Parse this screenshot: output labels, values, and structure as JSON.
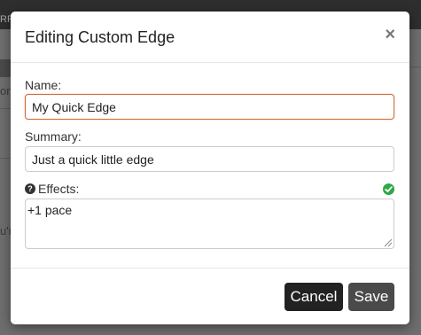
{
  "background": {
    "topbar_text": "RPO",
    "snippet_left_1": "onc",
    "snippet_left_2": "u'r"
  },
  "modal": {
    "title": "Editing Custom Edge",
    "close_symbol": "×",
    "name_label": "Name:",
    "name_value": "My Quick Edge",
    "summary_label": "Summary:",
    "summary_value": "Just a quick little edge",
    "effects_label": "Effects:",
    "effects_value": "+1 pace",
    "help_symbol": "?",
    "cancel_label": "Cancel",
    "save_label": "Save"
  },
  "colors": {
    "focus_border": "#d06a3a",
    "valid_check": "#2ea84a",
    "cancel_bg": "#222222",
    "save_bg": "#4a4a4a"
  },
  "icons": {
    "close": "close-icon",
    "help": "question-circle-icon",
    "valid": "check-circle-icon",
    "resize": "resize-handle-icon",
    "user": "user-icon"
  }
}
